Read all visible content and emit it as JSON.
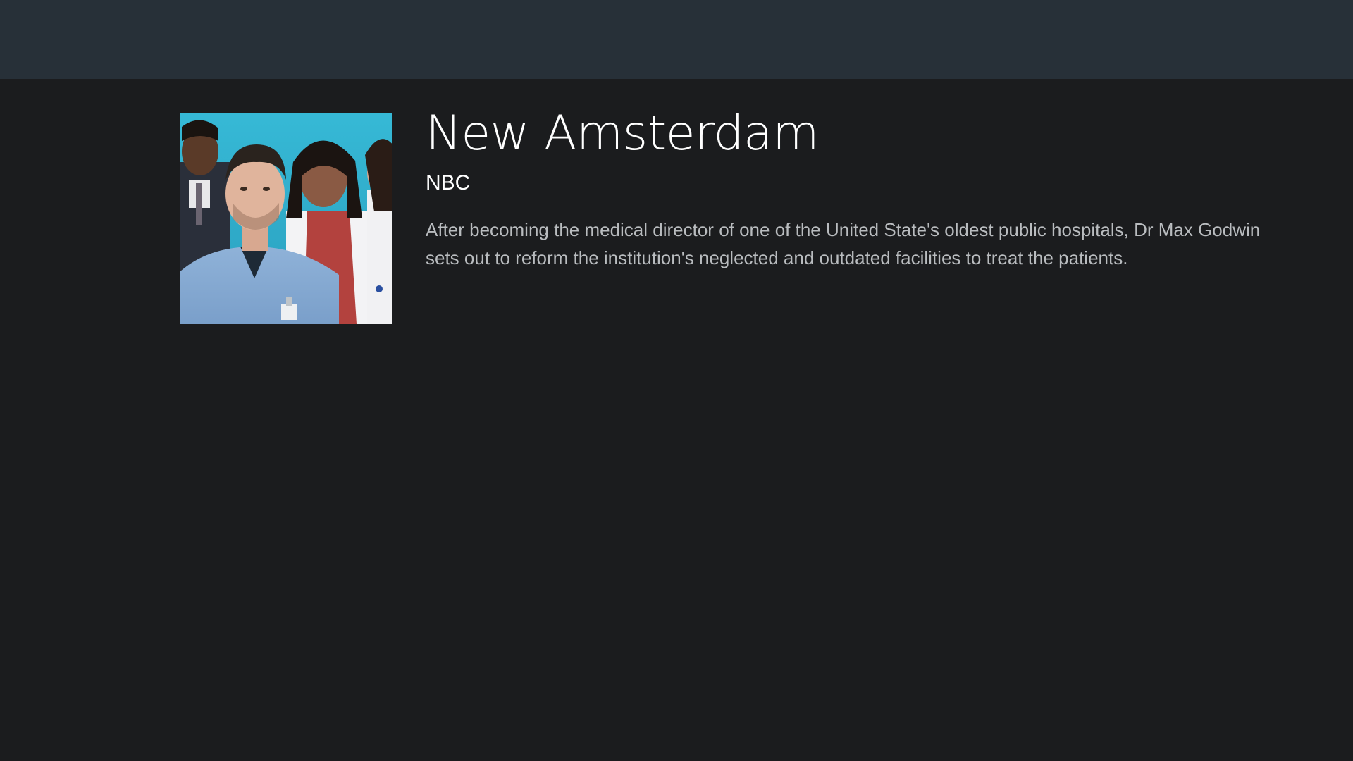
{
  "show": {
    "title": "New Amsterdam",
    "network": "NBC",
    "description": "After becoming the medical director of one of the United State's oldest public hospitals, Dr Max Godwin sets out to reform the institution's neglected and outdated facilities to treat the patients."
  },
  "colors": {
    "top_bar": "#273038",
    "background": "#1b1c1e",
    "title_text": "#ffffff",
    "description_text": "#b9bcbf",
    "poster_backdrop": "#2fb1cf"
  }
}
